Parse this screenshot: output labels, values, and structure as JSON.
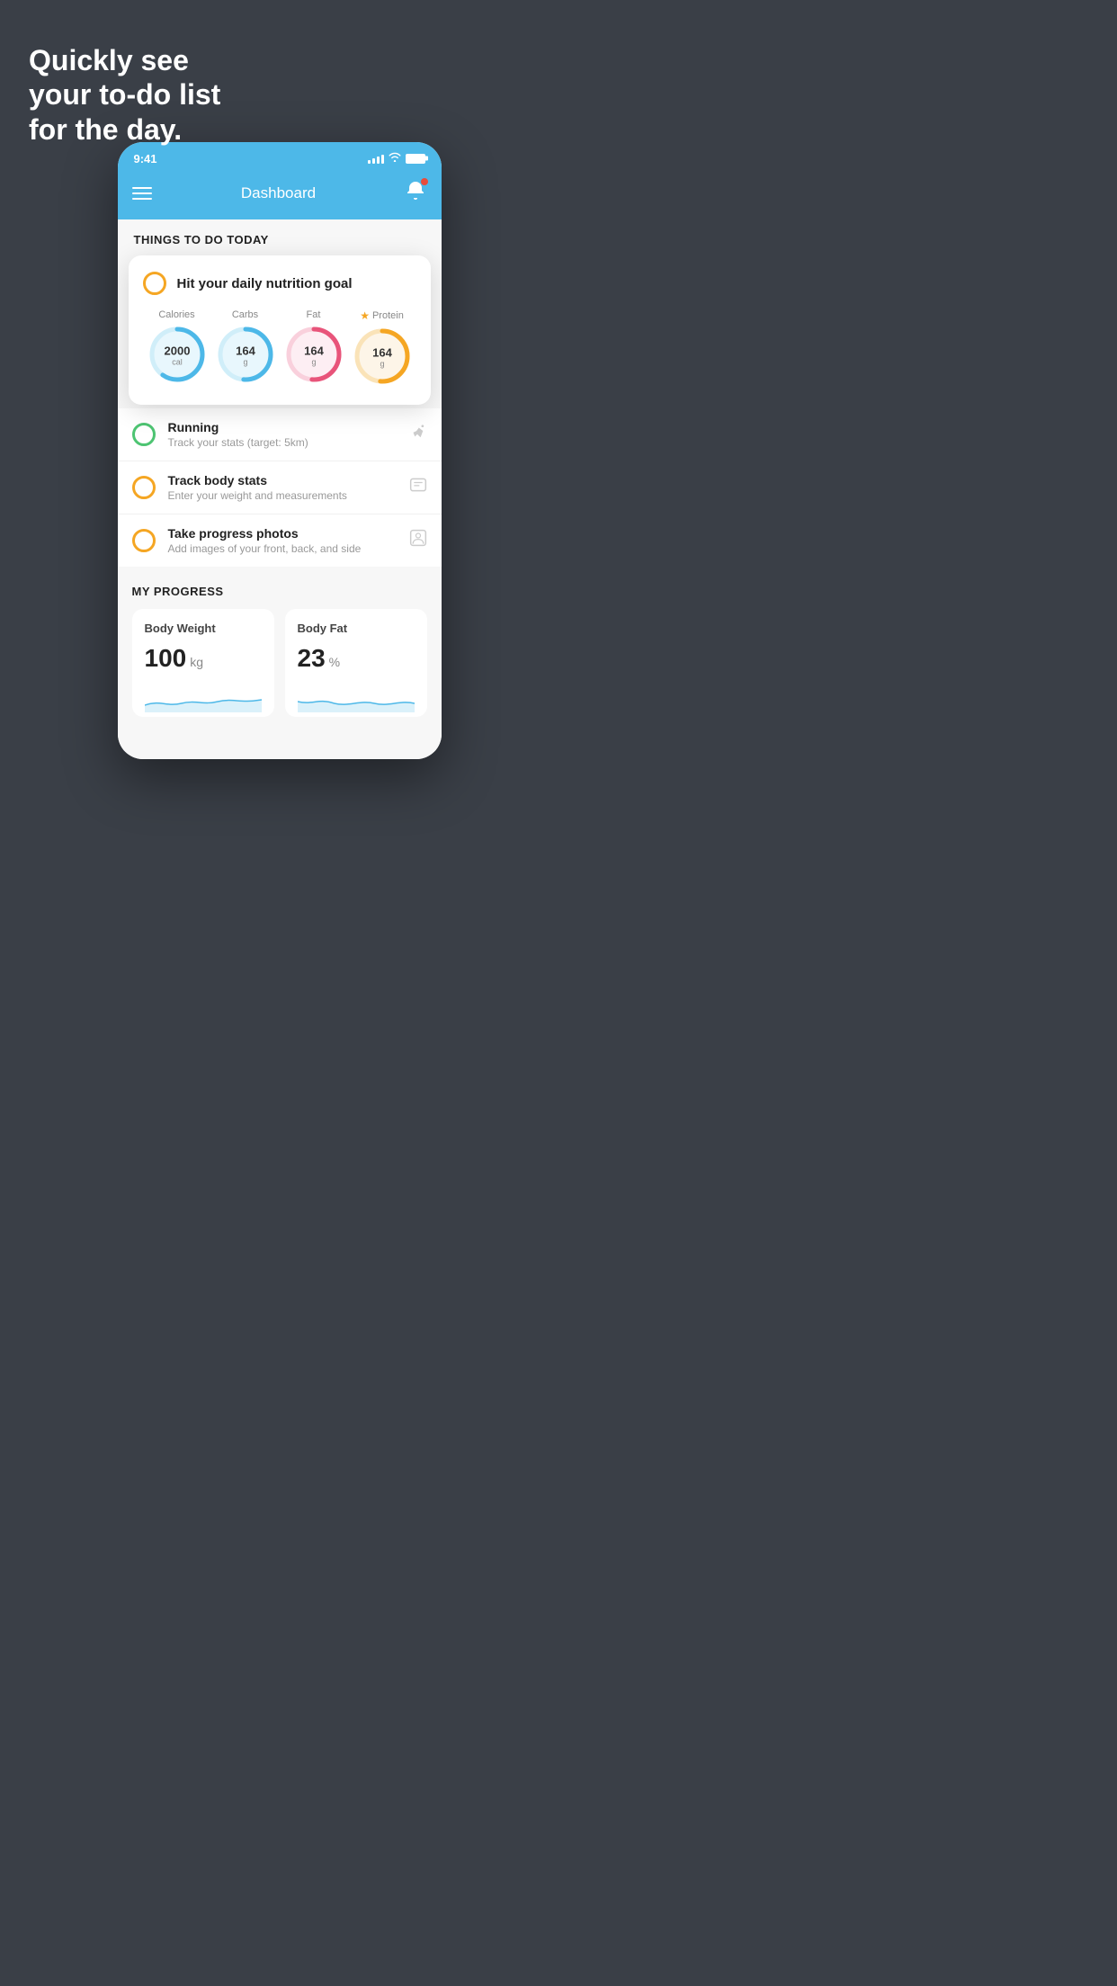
{
  "hero": {
    "line1": "Quickly see",
    "line2": "your to-do list",
    "line3": "for the day."
  },
  "status_bar": {
    "time": "9:41",
    "signal_bars": [
      4,
      6,
      8,
      10,
      12
    ],
    "wifi": "wifi",
    "battery": "battery"
  },
  "app_header": {
    "title": "Dashboard",
    "menu_icon": "☰",
    "bell_icon": "🔔"
  },
  "things_to_do": {
    "section_title": "THINGS TO DO TODAY"
  },
  "floating_card": {
    "task_label": "Hit your daily nutrition goal",
    "nutrients": [
      {
        "label": "Calories",
        "value": "2000",
        "unit": "cal",
        "color": "#4db8e8",
        "bg": "#e8f7fd",
        "star": false
      },
      {
        "label": "Carbs",
        "value": "164",
        "unit": "g",
        "color": "#4db8e8",
        "bg": "#e8f7fd",
        "star": false
      },
      {
        "label": "Fat",
        "value": "164",
        "unit": "g",
        "color": "#e8547a",
        "bg": "#fdeef3",
        "star": false
      },
      {
        "label": "Protein",
        "value": "164",
        "unit": "g",
        "color": "#f5a623",
        "bg": "#fdf5e8",
        "star": true
      }
    ]
  },
  "todo_items": [
    {
      "title": "Running",
      "subtitle": "Track your stats (target: 5km)",
      "circle_color": "#4dc472",
      "icon": "👟",
      "checked": true
    },
    {
      "title": "Track body stats",
      "subtitle": "Enter your weight and measurements",
      "circle_color": "#f5a623",
      "icon": "⚖",
      "checked": false
    },
    {
      "title": "Take progress photos",
      "subtitle": "Add images of your front, back, and side",
      "circle_color": "#f5a623",
      "icon": "👤",
      "checked": false
    }
  ],
  "progress": {
    "section_title": "MY PROGRESS",
    "cards": [
      {
        "title": "Body Weight",
        "value": "100",
        "unit": "kg"
      },
      {
        "title": "Body Fat",
        "value": "23",
        "unit": "%"
      }
    ]
  }
}
